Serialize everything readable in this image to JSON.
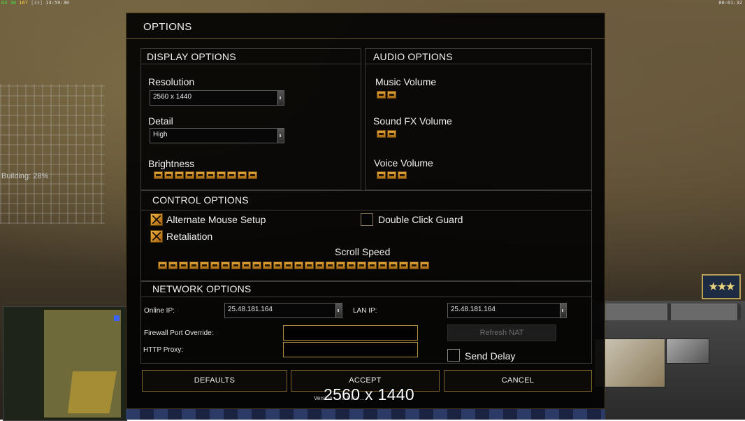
{
  "hud": {
    "top_left_green": "DX 30",
    "top_left_yellow": "167",
    "top_left_grey": "[33]",
    "top_left_time": "13:59:30",
    "top_right_time": "00:01:32",
    "building_status": "Building: 28%"
  },
  "dialog": {
    "title": "OPTIONS"
  },
  "display": {
    "header": "DISPLAY OPTIONS",
    "resolution_label": "Resolution",
    "resolution_value": "2560 x 1440",
    "detail_label": "Detail",
    "detail_value": "High",
    "brightness_label": "Brightness",
    "brightness_level": 10
  },
  "audio": {
    "header": "AUDIO OPTIONS",
    "music_label": "Music Volume",
    "music_level": 2,
    "sfx_label": "Sound FX Volume",
    "sfx_level": 2,
    "voice_label": "Voice Volume",
    "voice_level": 3
  },
  "control": {
    "header": "CONTROL OPTIONS",
    "alt_mouse_label": "Alternate Mouse Setup",
    "alt_mouse_checked": true,
    "double_click_label": "Double Click Guard",
    "double_click_checked": false,
    "retaliation_label": "Retaliation",
    "retaliation_checked": true,
    "scroll_speed_label": "Scroll Speed",
    "scroll_speed_level": 26
  },
  "network": {
    "header": "NETWORK OPTIONS",
    "online_ip_label": "Online IP:",
    "online_ip_value": "25.48.181.164",
    "lan_ip_label": "LAN IP:",
    "lan_ip_value": "25.48.181.164",
    "firewall_label": "Firewall Port Override:",
    "firewall_value": "",
    "http_proxy_label": "HTTP Proxy:",
    "http_proxy_value": "",
    "refresh_nat_label": "Refresh NAT",
    "send_delay_label": "Send Delay",
    "send_delay_checked": false
  },
  "buttons": {
    "defaults": "DEFAULTS",
    "accept": "ACCEPT",
    "cancel": "CANCEL"
  },
  "footer": {
    "version_text": "Version ... ra Beta ...",
    "resolution_overlay": "2560 x 1440"
  },
  "colors": {
    "accent_gold": "#d7962a",
    "border_gold": "#b08e3c"
  }
}
